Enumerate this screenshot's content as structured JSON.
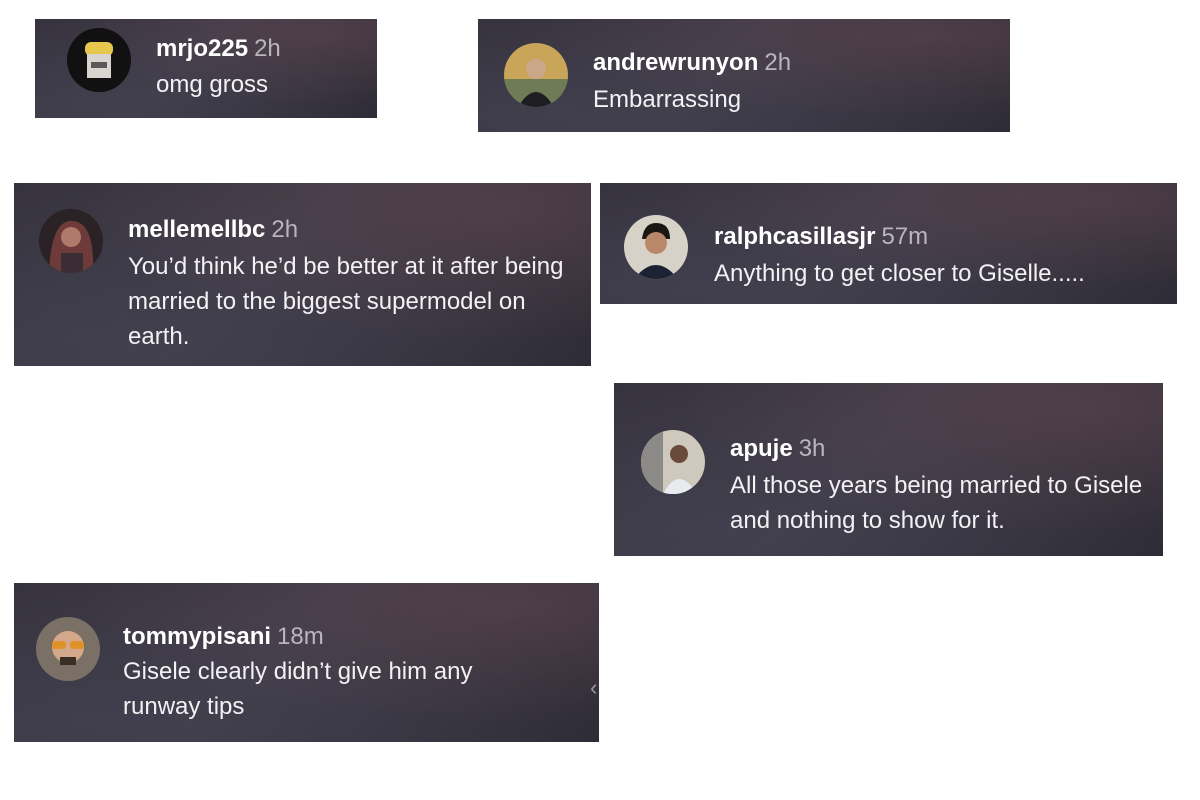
{
  "comments": [
    {
      "username": "mrjo225",
      "time": "2h",
      "text": "omg gross",
      "avatar_icon": "cartoon-avatar"
    },
    {
      "username": "andrewrunyon",
      "time": "2h",
      "text": "Embarrassing",
      "avatar_icon": "person-avatar"
    },
    {
      "username": "mellemellbc",
      "time": "2h",
      "text": "You’d think he’d be better at it after being married to the biggest supermodel on earth.",
      "avatar_icon": "person-avatar"
    },
    {
      "username": "ralphcasillasjr",
      "time": "57m",
      "text": "Anything to get closer to Giselle.....",
      "avatar_icon": "person-avatar"
    },
    {
      "username": "apuje",
      "time": "3h",
      "text": "All those years being married to Gisele and nothing to show for it.",
      "avatar_icon": "person-avatar"
    },
    {
      "username": "tommypisani",
      "time": "18m",
      "text": "Gisele clearly didn’t give him any runway tips",
      "avatar_icon": "person-avatar"
    }
  ],
  "colors": {
    "card_bg": "#36333e",
    "username": "#ffffff",
    "timestamp": "#b9b6c0",
    "text": "#f2f1f4"
  }
}
